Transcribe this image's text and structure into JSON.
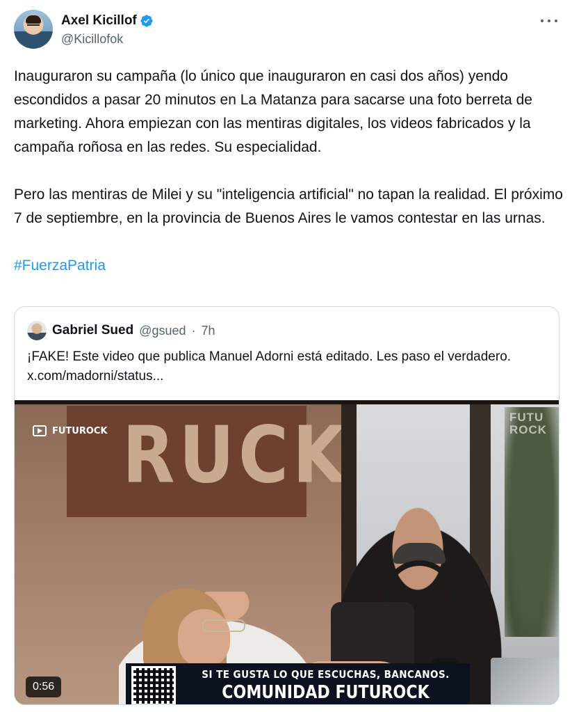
{
  "author": {
    "display_name": "Axel Kicillof",
    "handle": "@Kicillofok",
    "verified_icon": "verified-badge-icon",
    "verified_color": "#1d9bf0"
  },
  "tweet": {
    "paragraph_1": "Inauguraron su campaña (lo único que inauguraron en casi dos años) yendo escondidos a pasar 20 minutos en La Matanza para sacarse una foto berreta de marketing. Ahora empiezan con las mentiras digitales, los videos fabricados y la campaña roñosa en las redes. Su especialidad.",
    "paragraph_2": "Pero las mentiras de Milei y su \"inteligencia artificial\" no tapan la realidad. El próximo 7 de septiembre, en la provincia de Buenos Aires le vamos contestar en las urnas.",
    "hashtag": "#FuerzaPatria",
    "link_color": "#1d9bf0"
  },
  "quoted_tweet": {
    "display_name": "Gabriel Sued",
    "handle": "@gsued",
    "separator": "·",
    "time": "7h",
    "text": "¡FAKE! Este video que publica Manuel Adorni está editado. Les paso el verdadero.",
    "link": "x.com/madorni/status..."
  },
  "video": {
    "duration": "0:56",
    "channel_logo": "FUTUROCK",
    "sign_text": "RUCK",
    "window_text_1": "FUTU",
    "window_text_2": "ROCK",
    "banner_line_1": "SI TE GUSTA LO QUE ESCUCHAS, BANCANOS.",
    "banner_line_2": "COMUNIDAD FUTUROCK"
  }
}
